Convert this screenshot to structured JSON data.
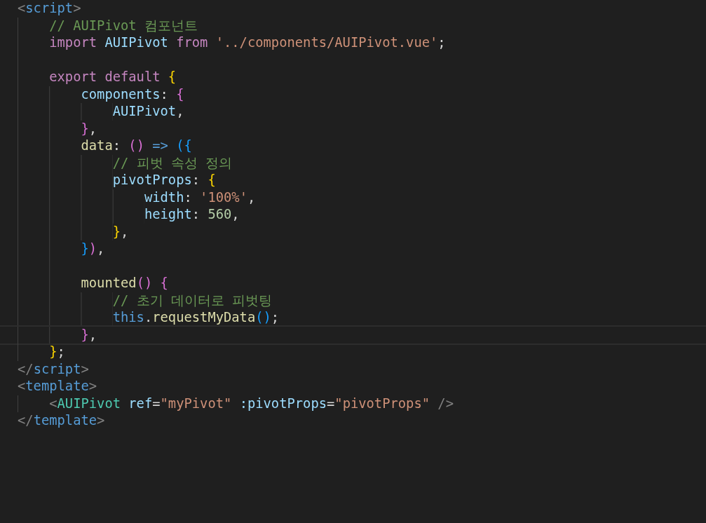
{
  "editor": {
    "lines": [
      {
        "current": false,
        "tokens": [
          {
            "text": "<",
            "kind": "angle"
          },
          {
            "text": "script",
            "kind": "tag"
          },
          {
            "text": ">",
            "kind": "angle"
          }
        ]
      },
      {
        "current": false,
        "tokens": [
          {
            "text": "    // AUIPivot 컴포넌트",
            "kind": "comment"
          }
        ]
      },
      {
        "current": false,
        "tokens": [
          {
            "text": "    import ",
            "kind": "keyword"
          },
          {
            "text": "AUIPivot ",
            "kind": "variable"
          },
          {
            "text": "from ",
            "kind": "keyword"
          },
          {
            "text": "'../components/AUIPivot.vue'",
            "kind": "string"
          },
          {
            "text": ";",
            "kind": "punct"
          }
        ]
      },
      {
        "current": false
      },
      {
        "current": false,
        "tokens": [
          {
            "text": "    export default ",
            "kind": "keyword"
          },
          {
            "text": "{",
            "kind": "brace1"
          }
        ]
      },
      {
        "current": false,
        "tokens": [
          {
            "text": "        components",
            "kind": "variable"
          },
          {
            "text": ": ",
            "kind": "punct"
          },
          {
            "text": "{",
            "kind": "brace2"
          }
        ]
      },
      {
        "current": false,
        "tokens": [
          {
            "text": "            AUIPivot",
            "kind": "variable"
          },
          {
            "text": ",",
            "kind": "punct"
          }
        ]
      },
      {
        "current": false,
        "tokens": [
          {
            "text": "        }",
            "kind": "brace2"
          },
          {
            "text": ",",
            "kind": "punct"
          }
        ]
      },
      {
        "current": false,
        "tokens": [
          {
            "text": "        data",
            "kind": "function"
          },
          {
            "text": ": ",
            "kind": "punct"
          },
          {
            "text": "() ",
            "kind": "brace2"
          },
          {
            "text": "=> ",
            "kind": "tag"
          },
          {
            "text": "({",
            "kind": "brace3"
          }
        ]
      },
      {
        "current": false,
        "tokens": [
          {
            "text": "            // 피벗 속성 정의",
            "kind": "comment"
          }
        ]
      },
      {
        "current": false,
        "tokens": [
          {
            "text": "            pivotProps",
            "kind": "variable"
          },
          {
            "text": ": ",
            "kind": "punct"
          },
          {
            "text": "{",
            "kind": "brace1"
          }
        ]
      },
      {
        "current": false,
        "tokens": [
          {
            "text": "                width",
            "kind": "variable"
          },
          {
            "text": ": ",
            "kind": "punct"
          },
          {
            "text": "'100%'",
            "kind": "string"
          },
          {
            "text": ",",
            "kind": "punct"
          }
        ]
      },
      {
        "current": false,
        "tokens": [
          {
            "text": "                height",
            "kind": "variable"
          },
          {
            "text": ": ",
            "kind": "punct"
          },
          {
            "text": "560",
            "kind": "number"
          },
          {
            "text": ",",
            "kind": "punct"
          }
        ]
      },
      {
        "current": false,
        "tokens": [
          {
            "text": "            }",
            "kind": "brace1"
          },
          {
            "text": ",",
            "kind": "punct"
          }
        ]
      },
      {
        "current": false,
        "tokens": [
          {
            "text": "        }",
            "kind": "brace3"
          },
          {
            "text": ")",
            "kind": "brace2"
          },
          {
            "text": ",",
            "kind": "punct"
          }
        ]
      },
      {
        "current": false
      },
      {
        "current": false,
        "tokens": [
          {
            "text": "        mounted",
            "kind": "function"
          },
          {
            "text": "() ",
            "kind": "brace2"
          },
          {
            "text": "{",
            "kind": "brace2"
          }
        ]
      },
      {
        "current": false,
        "tokens": [
          {
            "text": "            // 초기 데이터로 피벗팅",
            "kind": "comment"
          }
        ]
      },
      {
        "current": false,
        "tokens": [
          {
            "text": "            this",
            "kind": "tag"
          },
          {
            "text": ".",
            "kind": "punct"
          },
          {
            "text": "requestMyData",
            "kind": "function"
          },
          {
            "text": "()",
            "kind": "brace3"
          },
          {
            "text": ";",
            "kind": "punct"
          }
        ]
      },
      {
        "current": true,
        "tokens": [
          {
            "text": "        }",
            "kind": "brace2"
          },
          {
            "text": ",",
            "kind": "punct"
          }
        ]
      },
      {
        "current": false,
        "tokens": [
          {
            "text": "    }",
            "kind": "brace1"
          },
          {
            "text": ";",
            "kind": "punct"
          }
        ]
      },
      {
        "current": false,
        "tokens": [
          {
            "text": "</",
            "kind": "angle"
          },
          {
            "text": "script",
            "kind": "tag"
          },
          {
            "text": ">",
            "kind": "angle"
          }
        ]
      },
      {
        "current": false,
        "tokens": [
          {
            "text": "<",
            "kind": "angle"
          },
          {
            "text": "template",
            "kind": "tag"
          },
          {
            "text": ">",
            "kind": "angle"
          }
        ]
      },
      {
        "current": false,
        "tokens": [
          {
            "text": "    <",
            "kind": "angle"
          },
          {
            "text": "AUIPivot ",
            "kind": "component"
          },
          {
            "text": "ref",
            "kind": "variable"
          },
          {
            "text": "=",
            "kind": "punct"
          },
          {
            "text": "\"myPivot\" ",
            "kind": "string"
          },
          {
            "text": ":pivotProps",
            "kind": "variable"
          },
          {
            "text": "=",
            "kind": "punct"
          },
          {
            "text": "\"pivotProps\" ",
            "kind": "string"
          },
          {
            "text": "/>",
            "kind": "angle"
          }
        ]
      },
      {
        "current": false,
        "tokens": [
          {
            "text": "</",
            "kind": "angle"
          },
          {
            "text": "template",
            "kind": "tag"
          },
          {
            "text": ">",
            "kind": "angle"
          }
        ]
      }
    ]
  }
}
